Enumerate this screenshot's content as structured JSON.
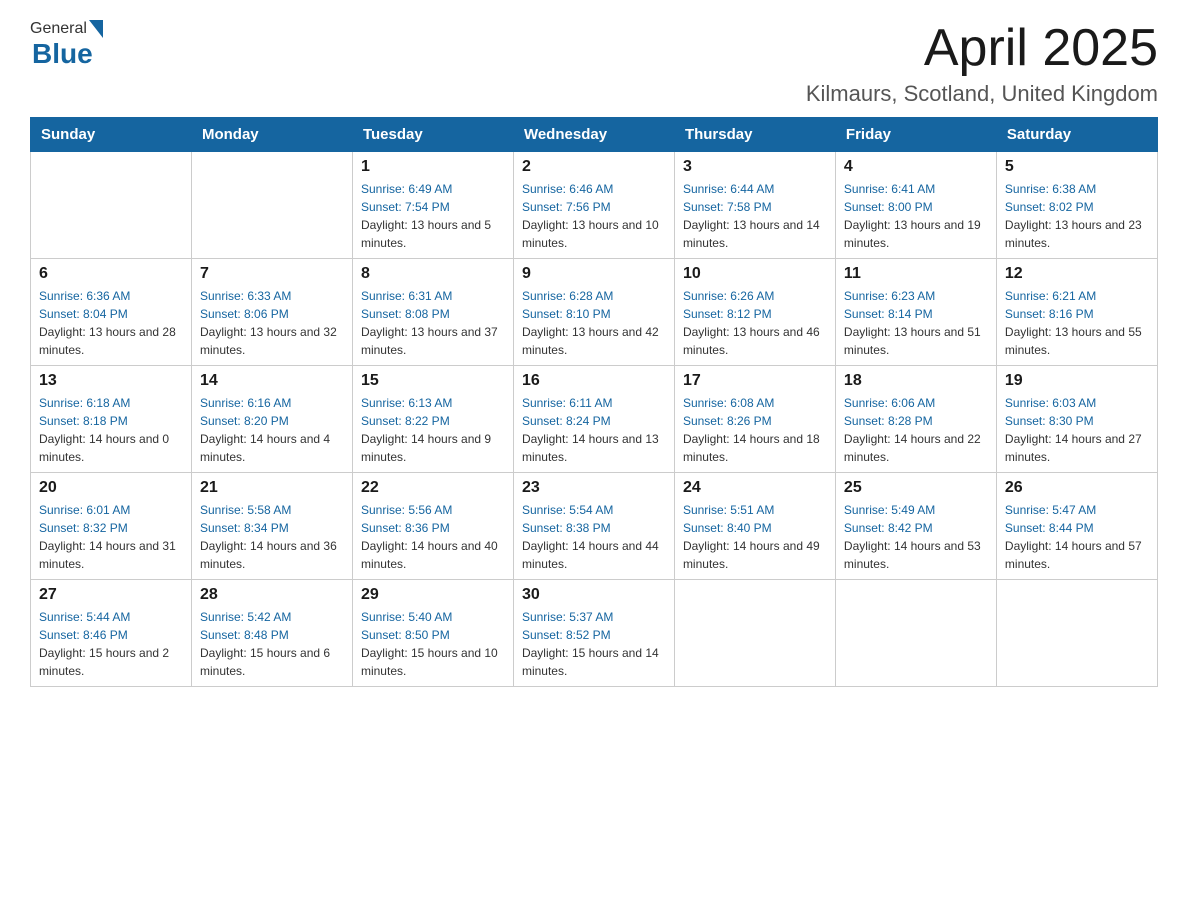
{
  "header": {
    "logo_general": "General",
    "logo_blue": "Blue",
    "month_title": "April 2025",
    "location": "Kilmaurs, Scotland, United Kingdom"
  },
  "weekdays": [
    "Sunday",
    "Monday",
    "Tuesday",
    "Wednesday",
    "Thursday",
    "Friday",
    "Saturday"
  ],
  "weeks": [
    [
      {
        "day": "",
        "sunrise": "",
        "sunset": "",
        "daylight": ""
      },
      {
        "day": "",
        "sunrise": "",
        "sunset": "",
        "daylight": ""
      },
      {
        "day": "1",
        "sunrise": "Sunrise: 6:49 AM",
        "sunset": "Sunset: 7:54 PM",
        "daylight": "Daylight: 13 hours and 5 minutes."
      },
      {
        "day": "2",
        "sunrise": "Sunrise: 6:46 AM",
        "sunset": "Sunset: 7:56 PM",
        "daylight": "Daylight: 13 hours and 10 minutes."
      },
      {
        "day": "3",
        "sunrise": "Sunrise: 6:44 AM",
        "sunset": "Sunset: 7:58 PM",
        "daylight": "Daylight: 13 hours and 14 minutes."
      },
      {
        "day": "4",
        "sunrise": "Sunrise: 6:41 AM",
        "sunset": "Sunset: 8:00 PM",
        "daylight": "Daylight: 13 hours and 19 minutes."
      },
      {
        "day": "5",
        "sunrise": "Sunrise: 6:38 AM",
        "sunset": "Sunset: 8:02 PM",
        "daylight": "Daylight: 13 hours and 23 minutes."
      }
    ],
    [
      {
        "day": "6",
        "sunrise": "Sunrise: 6:36 AM",
        "sunset": "Sunset: 8:04 PM",
        "daylight": "Daylight: 13 hours and 28 minutes."
      },
      {
        "day": "7",
        "sunrise": "Sunrise: 6:33 AM",
        "sunset": "Sunset: 8:06 PM",
        "daylight": "Daylight: 13 hours and 32 minutes."
      },
      {
        "day": "8",
        "sunrise": "Sunrise: 6:31 AM",
        "sunset": "Sunset: 8:08 PM",
        "daylight": "Daylight: 13 hours and 37 minutes."
      },
      {
        "day": "9",
        "sunrise": "Sunrise: 6:28 AM",
        "sunset": "Sunset: 8:10 PM",
        "daylight": "Daylight: 13 hours and 42 minutes."
      },
      {
        "day": "10",
        "sunrise": "Sunrise: 6:26 AM",
        "sunset": "Sunset: 8:12 PM",
        "daylight": "Daylight: 13 hours and 46 minutes."
      },
      {
        "day": "11",
        "sunrise": "Sunrise: 6:23 AM",
        "sunset": "Sunset: 8:14 PM",
        "daylight": "Daylight: 13 hours and 51 minutes."
      },
      {
        "day": "12",
        "sunrise": "Sunrise: 6:21 AM",
        "sunset": "Sunset: 8:16 PM",
        "daylight": "Daylight: 13 hours and 55 minutes."
      }
    ],
    [
      {
        "day": "13",
        "sunrise": "Sunrise: 6:18 AM",
        "sunset": "Sunset: 8:18 PM",
        "daylight": "Daylight: 14 hours and 0 minutes."
      },
      {
        "day": "14",
        "sunrise": "Sunrise: 6:16 AM",
        "sunset": "Sunset: 8:20 PM",
        "daylight": "Daylight: 14 hours and 4 minutes."
      },
      {
        "day": "15",
        "sunrise": "Sunrise: 6:13 AM",
        "sunset": "Sunset: 8:22 PM",
        "daylight": "Daylight: 14 hours and 9 minutes."
      },
      {
        "day": "16",
        "sunrise": "Sunrise: 6:11 AM",
        "sunset": "Sunset: 8:24 PM",
        "daylight": "Daylight: 14 hours and 13 minutes."
      },
      {
        "day": "17",
        "sunrise": "Sunrise: 6:08 AM",
        "sunset": "Sunset: 8:26 PM",
        "daylight": "Daylight: 14 hours and 18 minutes."
      },
      {
        "day": "18",
        "sunrise": "Sunrise: 6:06 AM",
        "sunset": "Sunset: 8:28 PM",
        "daylight": "Daylight: 14 hours and 22 minutes."
      },
      {
        "day": "19",
        "sunrise": "Sunrise: 6:03 AM",
        "sunset": "Sunset: 8:30 PM",
        "daylight": "Daylight: 14 hours and 27 minutes."
      }
    ],
    [
      {
        "day": "20",
        "sunrise": "Sunrise: 6:01 AM",
        "sunset": "Sunset: 8:32 PM",
        "daylight": "Daylight: 14 hours and 31 minutes."
      },
      {
        "day": "21",
        "sunrise": "Sunrise: 5:58 AM",
        "sunset": "Sunset: 8:34 PM",
        "daylight": "Daylight: 14 hours and 36 minutes."
      },
      {
        "day": "22",
        "sunrise": "Sunrise: 5:56 AM",
        "sunset": "Sunset: 8:36 PM",
        "daylight": "Daylight: 14 hours and 40 minutes."
      },
      {
        "day": "23",
        "sunrise": "Sunrise: 5:54 AM",
        "sunset": "Sunset: 8:38 PM",
        "daylight": "Daylight: 14 hours and 44 minutes."
      },
      {
        "day": "24",
        "sunrise": "Sunrise: 5:51 AM",
        "sunset": "Sunset: 8:40 PM",
        "daylight": "Daylight: 14 hours and 49 minutes."
      },
      {
        "day": "25",
        "sunrise": "Sunrise: 5:49 AM",
        "sunset": "Sunset: 8:42 PM",
        "daylight": "Daylight: 14 hours and 53 minutes."
      },
      {
        "day": "26",
        "sunrise": "Sunrise: 5:47 AM",
        "sunset": "Sunset: 8:44 PM",
        "daylight": "Daylight: 14 hours and 57 minutes."
      }
    ],
    [
      {
        "day": "27",
        "sunrise": "Sunrise: 5:44 AM",
        "sunset": "Sunset: 8:46 PM",
        "daylight": "Daylight: 15 hours and 2 minutes."
      },
      {
        "day": "28",
        "sunrise": "Sunrise: 5:42 AM",
        "sunset": "Sunset: 8:48 PM",
        "daylight": "Daylight: 15 hours and 6 minutes."
      },
      {
        "day": "29",
        "sunrise": "Sunrise: 5:40 AM",
        "sunset": "Sunset: 8:50 PM",
        "daylight": "Daylight: 15 hours and 10 minutes."
      },
      {
        "day": "30",
        "sunrise": "Sunrise: 5:37 AM",
        "sunset": "Sunset: 8:52 PM",
        "daylight": "Daylight: 15 hours and 14 minutes."
      },
      {
        "day": "",
        "sunrise": "",
        "sunset": "",
        "daylight": ""
      },
      {
        "day": "",
        "sunrise": "",
        "sunset": "",
        "daylight": ""
      },
      {
        "day": "",
        "sunrise": "",
        "sunset": "",
        "daylight": ""
      }
    ]
  ]
}
